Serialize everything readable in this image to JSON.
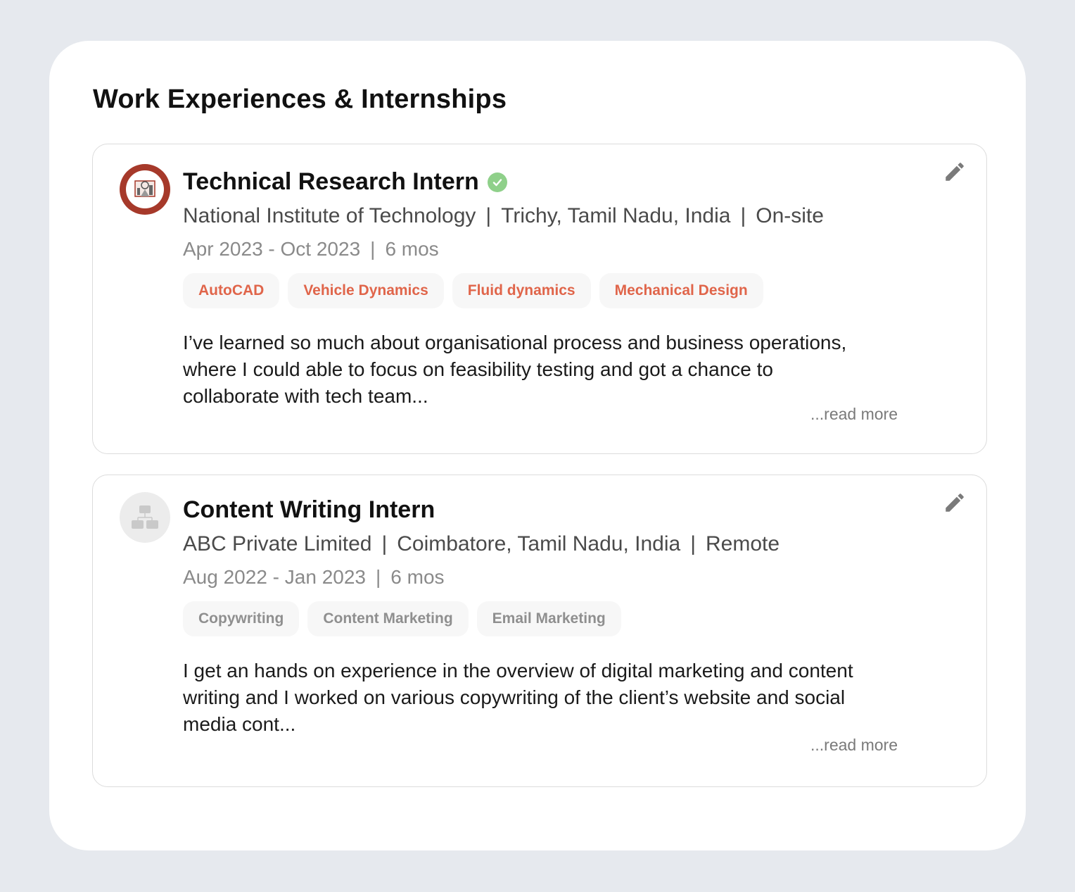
{
  "section": {
    "title": "Work Experiences & Internships"
  },
  "experiences": [
    {
      "title": "Technical Research Intern",
      "verified": true,
      "company": "National Institute of Technology",
      "location": "Trichy, Tamil Nadu, India",
      "work_mode": "On-site",
      "date_range": "Apr 2023 - Oct 2023",
      "duration": "6 mos",
      "logo_icon": "nit-trichy-logo",
      "skills": [
        "AutoCAD",
        "Vehicle Dynamics",
        "Fluid dynamics",
        "Mechanical Design"
      ],
      "description": "I’ve learned so much about organisational process and business operations, where I could able to focus on feasibility testing and got a chance to collaborate with tech team...",
      "read_more": "...read more",
      "edit_icon": "pencil-icon"
    },
    {
      "title": "Content Writing Intern",
      "verified": false,
      "company": "ABC Private Limited",
      "location": "Coimbatore, Tamil Nadu, India",
      "work_mode": "Remote",
      "date_range": "Aug 2022 - Jan 2023",
      "duration": "6 mos",
      "logo_icon": "org-chart-icon",
      "skills": [
        "Copywriting",
        "Content Marketing",
        "Email Marketing"
      ],
      "description": "I get an hands on experience in the overview of digital marketing and content writing and I worked on various copywriting of the client’s website and social media cont...",
      "read_more": "...read more",
      "edit_icon": "pencil-icon"
    }
  ],
  "colors": {
    "accent_tag_text": "#e0654a",
    "muted_tag_text": "#8f8f8f",
    "verified_badge": "#8fd08a",
    "page_background": "#e6e9ee"
  },
  "separator": "|"
}
